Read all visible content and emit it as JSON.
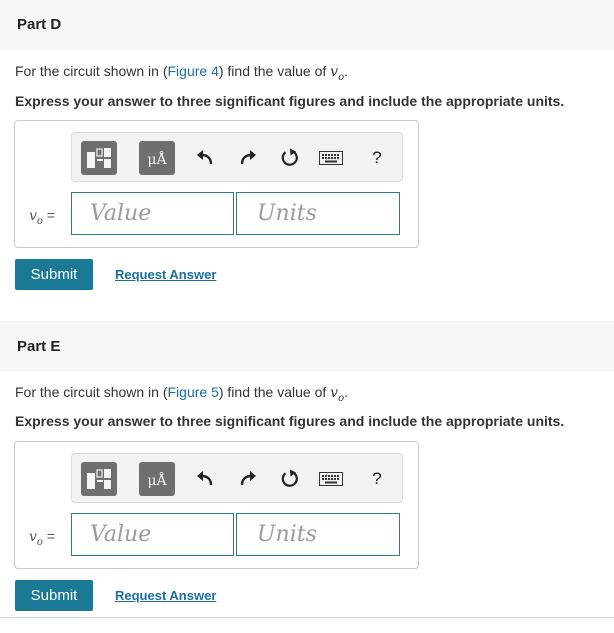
{
  "parts": [
    {
      "title": "Part D",
      "prompt_before": "For the circuit shown in (",
      "figure_link": "Figure 4",
      "prompt_after": ") find the value of ",
      "variable": "v",
      "variable_sub": "o",
      "prompt_end": ".",
      "instruction": "Express your answer to three significant figures and include the appropriate units.",
      "toolbar": {
        "units_symbol": "μÅ",
        "help_label": "?"
      },
      "answer_label_var": "v",
      "answer_label_sub": "o",
      "answer_label_eq": " =",
      "value_placeholder": "Value",
      "units_placeholder": "Units",
      "submit_label": "Submit",
      "request_label": "Request Answer"
    },
    {
      "title": "Part E",
      "prompt_before": "For the circuit shown in (",
      "figure_link": "Figure 5",
      "prompt_after": ") find the value of ",
      "variable": "v",
      "variable_sub": "o",
      "prompt_end": ".",
      "instruction": "Express your answer to three significant figures and include the appropriate units.",
      "toolbar": {
        "units_symbol": "μÅ",
        "help_label": "?"
      },
      "answer_label_var": "v",
      "answer_label_sub": "o",
      "answer_label_eq": " =",
      "value_placeholder": "Value",
      "units_placeholder": "Units",
      "submit_label": "Submit",
      "request_label": "Request Answer"
    }
  ],
  "icons": {
    "templates": "templates-icon",
    "units": "units-icon",
    "undo": "undo-icon",
    "redo": "redo-icon",
    "reset": "reset-icon",
    "keyboard": "keyboard-icon",
    "help": "help-icon"
  },
  "colors": {
    "header_bg": "#f6f6f6",
    "submit_bg": "#1a7a95",
    "link": "#1a6fa0",
    "input_border": "#2c7c8a"
  }
}
